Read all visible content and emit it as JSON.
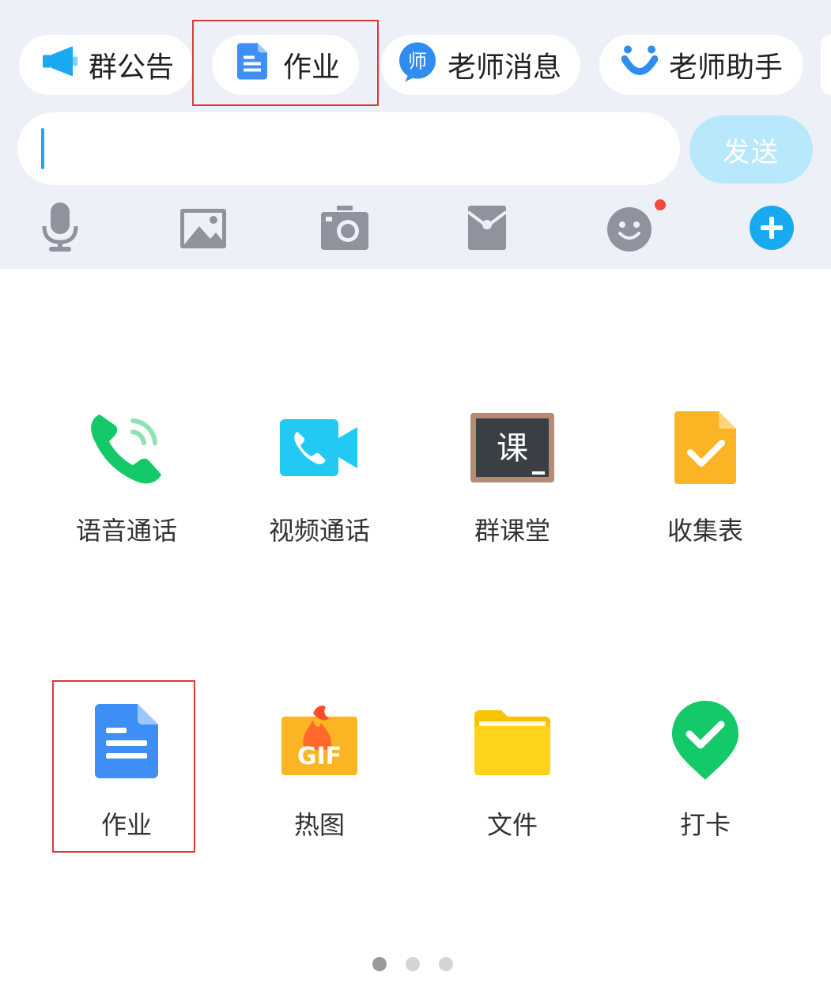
{
  "chips": [
    {
      "label": "群公告",
      "icon": "megaphone-icon"
    },
    {
      "label": "作业",
      "icon": "document-icon"
    },
    {
      "label": "老师消息",
      "icon": "teacher-badge-icon",
      "badge": "师"
    },
    {
      "label": "老师助手",
      "icon": "assistant-icon"
    }
  ],
  "input": {
    "placeholder": "",
    "value": ""
  },
  "send_label": "发送",
  "toolbar": [
    {
      "icon": "microphone-icon"
    },
    {
      "icon": "image-icon"
    },
    {
      "icon": "camera-icon"
    },
    {
      "icon": "red-packet-icon"
    },
    {
      "icon": "emoji-icon",
      "has_notification_dot": true
    },
    {
      "icon": "plus-icon"
    }
  ],
  "apps": [
    {
      "label": "语音通话",
      "icon": "phone-call-icon"
    },
    {
      "label": "视频通话",
      "icon": "video-call-icon"
    },
    {
      "label": "群课堂",
      "icon": "blackboard-icon",
      "glyph": "课"
    },
    {
      "label": "收集表",
      "icon": "collect-form-icon"
    },
    {
      "label": "作业",
      "icon": "homework-document-icon"
    },
    {
      "label": "热图",
      "icon": "gif-fire-icon",
      "glyph": "GIF"
    },
    {
      "label": "文件",
      "icon": "folder-icon"
    },
    {
      "label": "打卡",
      "icon": "check-in-pin-icon"
    }
  ],
  "pagination": {
    "pages": 3,
    "current": 1
  },
  "colors": {
    "accent": "#19a9f0",
    "highlight_box": "#d63b3b",
    "top_panel_bg": "#eef0f7",
    "send_disabled": "#b8e8fb",
    "notification_dot": "#f04b3e"
  }
}
